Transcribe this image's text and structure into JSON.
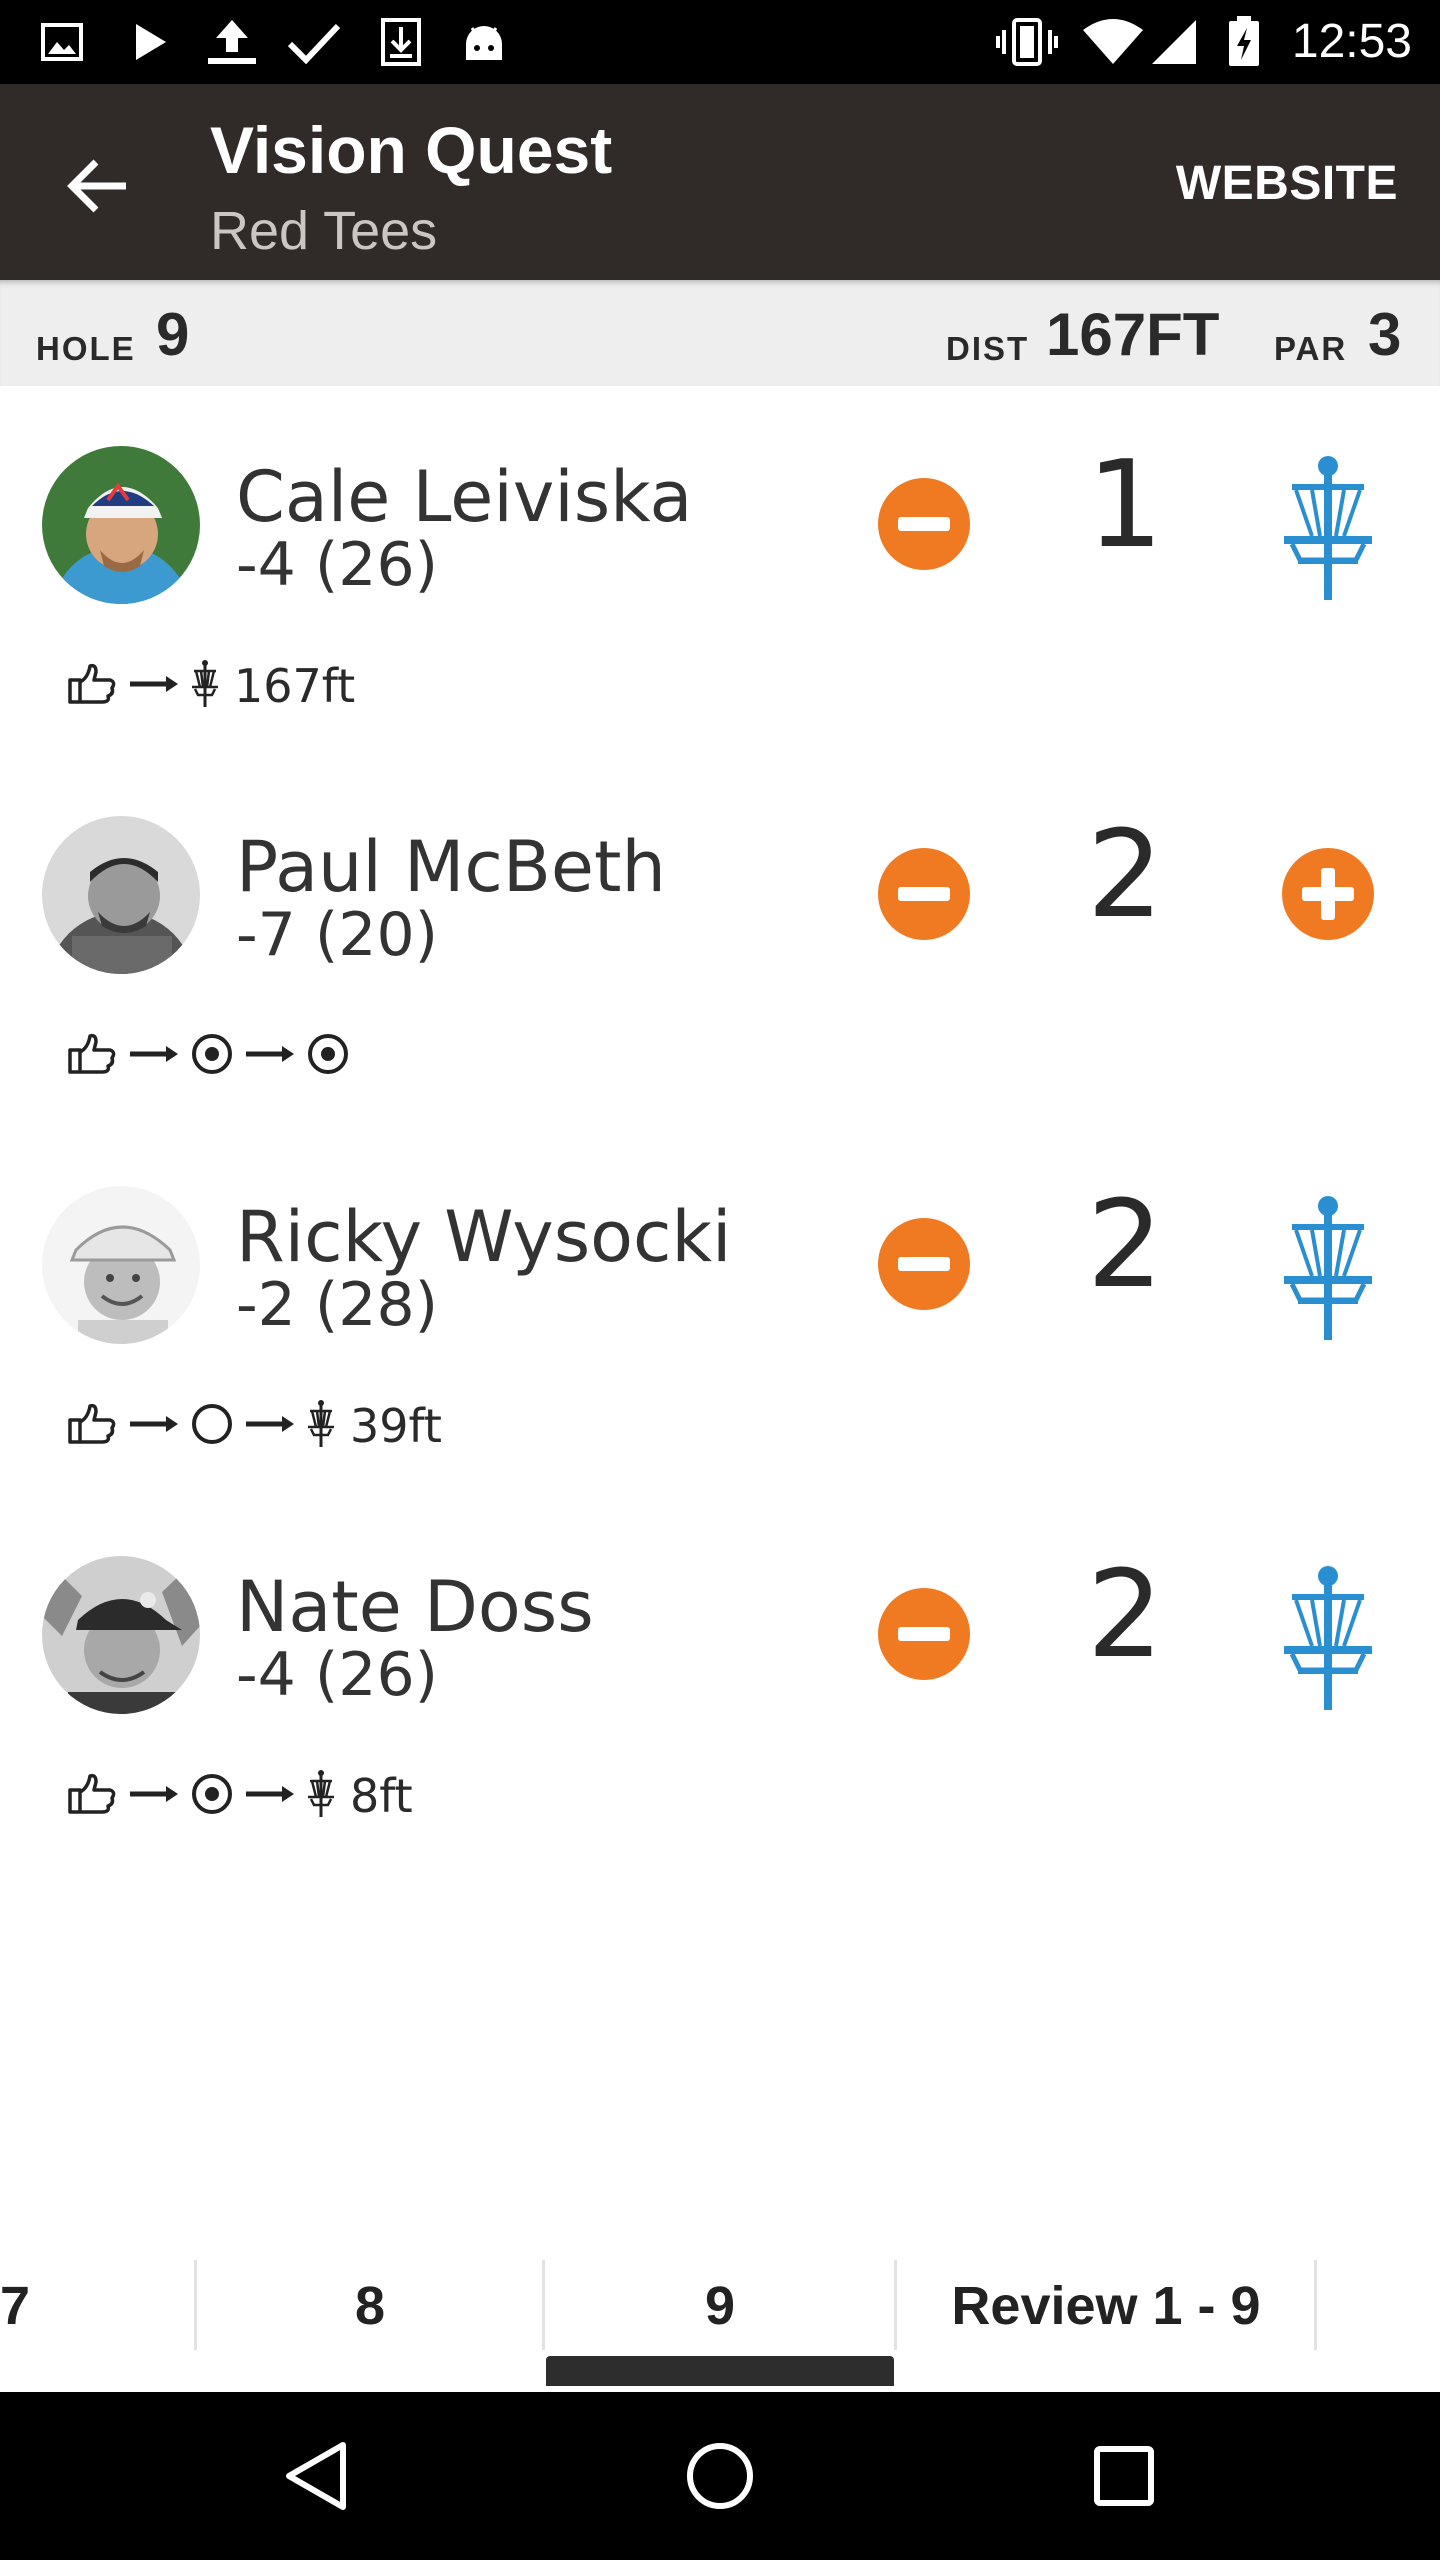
{
  "status_bar": {
    "time": "12:53",
    "left_icons": [
      "image-icon",
      "play-icon",
      "upload-icon",
      "check-icon",
      "download-icon",
      "android-icon"
    ],
    "right_icons": [
      "vibrate-icon",
      "wifi-icon",
      "signal-icon",
      "battery-charging-icon"
    ]
  },
  "app_bar": {
    "title": "Vision Quest",
    "subtitle": "Red Tees",
    "action": "WEBSITE"
  },
  "hole_info": {
    "hole_label": "HOLE",
    "hole_value": "9",
    "dist_label": "DIST",
    "dist_value": "167FT",
    "par_label": "PAR",
    "par_value": "3"
  },
  "players": [
    {
      "name": "Cale Leiviska",
      "score": "-4 (26)",
      "strokes": "1",
      "right_control": "basket-icon",
      "throws": [
        "tee",
        "basket"
      ],
      "throw_text": "167ft"
    },
    {
      "name": "Paul McBeth",
      "score": "-7 (20)",
      "strokes": "2",
      "right_control": "plus-button",
      "throws": [
        "tee",
        "target",
        "target"
      ],
      "throw_text": ""
    },
    {
      "name": "Ricky Wysocki",
      "score": "-2 (28)",
      "strokes": "2",
      "right_control": "basket-icon",
      "throws": [
        "tee",
        "circle",
        "basket"
      ],
      "throw_text": "39ft"
    },
    {
      "name": "Nate Doss",
      "score": "-4 (26)",
      "strokes": "2",
      "right_control": "basket-icon",
      "throws": [
        "tee",
        "target",
        "basket"
      ],
      "throw_text": "8ft"
    }
  ],
  "hole_tabs": {
    "tabs": [
      "7",
      "8",
      "9",
      "Review 1 - 9"
    ],
    "selected": "9"
  },
  "nav_bar": {
    "buttons": [
      "back-triangle-icon",
      "home-circle-icon",
      "recents-square-icon"
    ]
  },
  "colors": {
    "app_bar": "#302b29",
    "accent_orange": "#f07a22",
    "basket_blue": "#2a8fd0",
    "hole_bar": "#eeeeee"
  }
}
